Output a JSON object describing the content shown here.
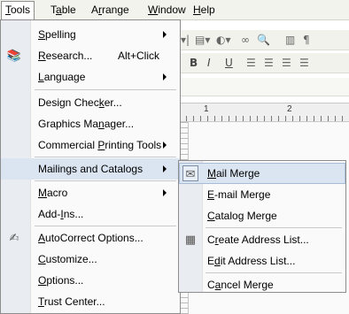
{
  "menubar": {
    "items": [
      {
        "label": "Tools",
        "u": "T",
        "rest": "ools",
        "open": true
      },
      {
        "label": "Table",
        "pre": "T",
        "u": "a",
        "rest": "ble"
      },
      {
        "label": "Arrange",
        "pre": "A",
        "u": "r",
        "rest": "range"
      },
      {
        "label": "Window",
        "u": "W",
        "rest": "indow"
      },
      {
        "label": "Help",
        "u": "H",
        "rest": "elp"
      }
    ]
  },
  "ruler": {
    "n1": "1",
    "n2": "2"
  },
  "tools_menu": {
    "items": [
      {
        "pre": "",
        "u": "S",
        "rest": "pelling",
        "submenu": true
      },
      {
        "pre": "",
        "u": "R",
        "rest": "esearch...",
        "shortcut": "Alt+Click",
        "icon": "research-icon"
      },
      {
        "pre": "",
        "u": "L",
        "rest": "anguage",
        "submenu": true
      },
      {
        "pre": "Design Chec",
        "u": "k",
        "rest": "er..."
      },
      {
        "pre": "Graphics Ma",
        "u": "n",
        "rest": "ager..."
      },
      {
        "pre": "Commercial ",
        "u": "P",
        "rest": "rinting Tools",
        "submenu": true
      },
      {
        "pre": "Mailings and Catalo",
        "u": "g",
        "rest": "s",
        "submenu": true,
        "highlighted": true
      },
      {
        "pre": "",
        "u": "M",
        "rest": "acro",
        "submenu": true
      },
      {
        "pre": "Add-",
        "u": "I",
        "rest": "ns..."
      },
      {
        "pre": "",
        "u": "A",
        "rest": "utoCorrect Options...",
        "icon": "autocorrect-icon"
      },
      {
        "pre": "",
        "u": "C",
        "rest": "ustomize..."
      },
      {
        "pre": "",
        "u": "O",
        "rest": "ptions..."
      },
      {
        "pre": "",
        "u": "T",
        "rest": "rust Center..."
      }
    ]
  },
  "mailings_submenu": {
    "items": [
      {
        "pre": "",
        "u": "M",
        "rest": "ail Merge",
        "icon": "mail-merge-icon",
        "highlighted": true
      },
      {
        "pre": "",
        "u": "E",
        "rest": "-mail Merge"
      },
      {
        "pre": "",
        "u": "C",
        "rest": "atalog Merge"
      },
      {
        "pre": "C",
        "u": "r",
        "rest": "eate Address List...",
        "icon": "address-list-icon"
      },
      {
        "pre": "E",
        "u": "d",
        "rest": "it Address List..."
      },
      {
        "pre": "C",
        "u": "a",
        "rest": "ncel Merge"
      }
    ]
  }
}
